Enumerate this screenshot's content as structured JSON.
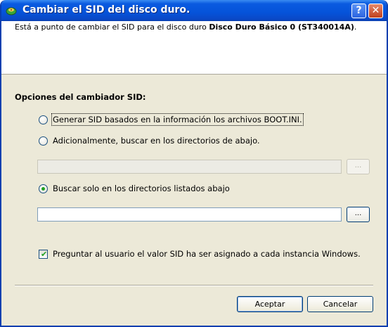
{
  "window": {
    "title": "Cambiar el SID del disco duro.",
    "help_button": "?",
    "close_button": "✕"
  },
  "header": {
    "text_prefix": "Está a punto de cambiar el SID para el disco duro ",
    "disk_name": "Disco Duro Básico 0 (ST340014A)",
    "text_suffix": "."
  },
  "options": {
    "title": "Opciones del cambiador SID:",
    "radio_generate": {
      "label": "Generar SID basados en la información los archivos BOOT.INI.",
      "checked": false
    },
    "radio_additional": {
      "label": "Adicionalmente, buscar en los directorios de abajo.",
      "checked": false
    },
    "additional_path": {
      "value": "",
      "disabled": true
    },
    "additional_browse": "...",
    "radio_only_listed": {
      "label": "Buscar solo en los directorios listados abajo",
      "checked": true
    },
    "listed_path": {
      "value": "",
      "disabled": false
    },
    "listed_browse": "...",
    "ask_user": {
      "label": "Preguntar al usuario el valor SID ha ser asignado a cada instancia Windows.",
      "checked": true
    }
  },
  "buttons": {
    "accept": "Aceptar",
    "cancel": "Cancelar"
  },
  "colors": {
    "titlebar": "#0553d9",
    "dialog_bg": "#ece9d8",
    "radio_dot": "#21a121"
  }
}
